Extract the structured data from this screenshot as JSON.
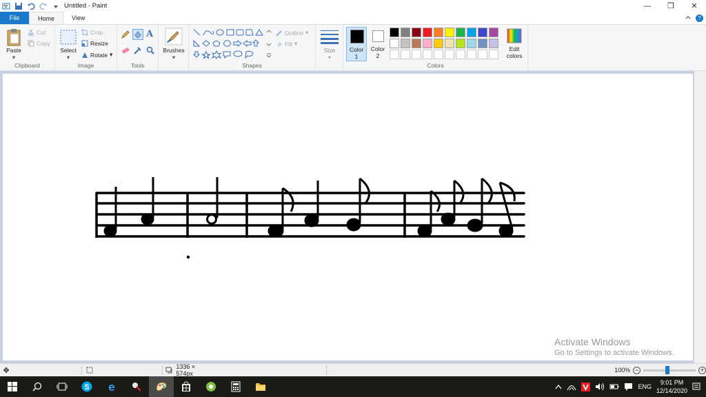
{
  "window": {
    "title": "Untitled - Paint",
    "minimize": "—",
    "restore": "❐",
    "close": "✕"
  },
  "tabs": [
    {
      "label": "File"
    },
    {
      "label": "Home"
    },
    {
      "label": "View"
    }
  ],
  "ribbon": {
    "clipboard": {
      "label": "Clipboard",
      "paste": "Paste",
      "cut": "Cut",
      "copy": "Copy"
    },
    "image": {
      "label": "Image",
      "select": "Select",
      "crop": "Crop",
      "resize": "Resize",
      "rotate": "Rotate"
    },
    "tools": {
      "label": "Tools"
    },
    "brushes": {
      "label": "Brushes"
    },
    "shapes": {
      "label": "Shapes",
      "outline": "Outline",
      "fill": "Fill"
    },
    "size": {
      "label": "Size"
    },
    "colors": {
      "label": "Colors",
      "color1": "Color\n1",
      "color1_a": "Color",
      "color1_b": "1",
      "color2_a": "Color",
      "color2_b": "2",
      "edit_a": "Edit",
      "edit_b": "colors",
      "color1_value": "#000000",
      "color2_value": "#ffffff",
      "palette_row1": [
        "#000000",
        "#7f7f7f",
        "#880015",
        "#ed1c24",
        "#ff7f27",
        "#fff200",
        "#22b14c",
        "#00a2e8",
        "#3f48cc",
        "#a349a4"
      ],
      "palette_row2": [
        "#ffffff",
        "#c3c3c3",
        "#b97a57",
        "#ffaec9",
        "#ffc90e",
        "#efe4b0",
        "#b5e61d",
        "#99d9ea",
        "#7092be",
        "#c8bfe7"
      ]
    }
  },
  "status": {
    "dimensions": "1336 × 574px",
    "zoom": "100%"
  },
  "watermark": {
    "line1": "Activate Windows",
    "line2": "Go to Settings to activate Windows."
  },
  "tray": {
    "lang": "ENG",
    "time": "9:01 PM",
    "date": "12/14/2020"
  },
  "colors": {
    "accent": "#1979ca",
    "workspace": "#c8d1e0",
    "taskbar": "#1b1a16"
  }
}
